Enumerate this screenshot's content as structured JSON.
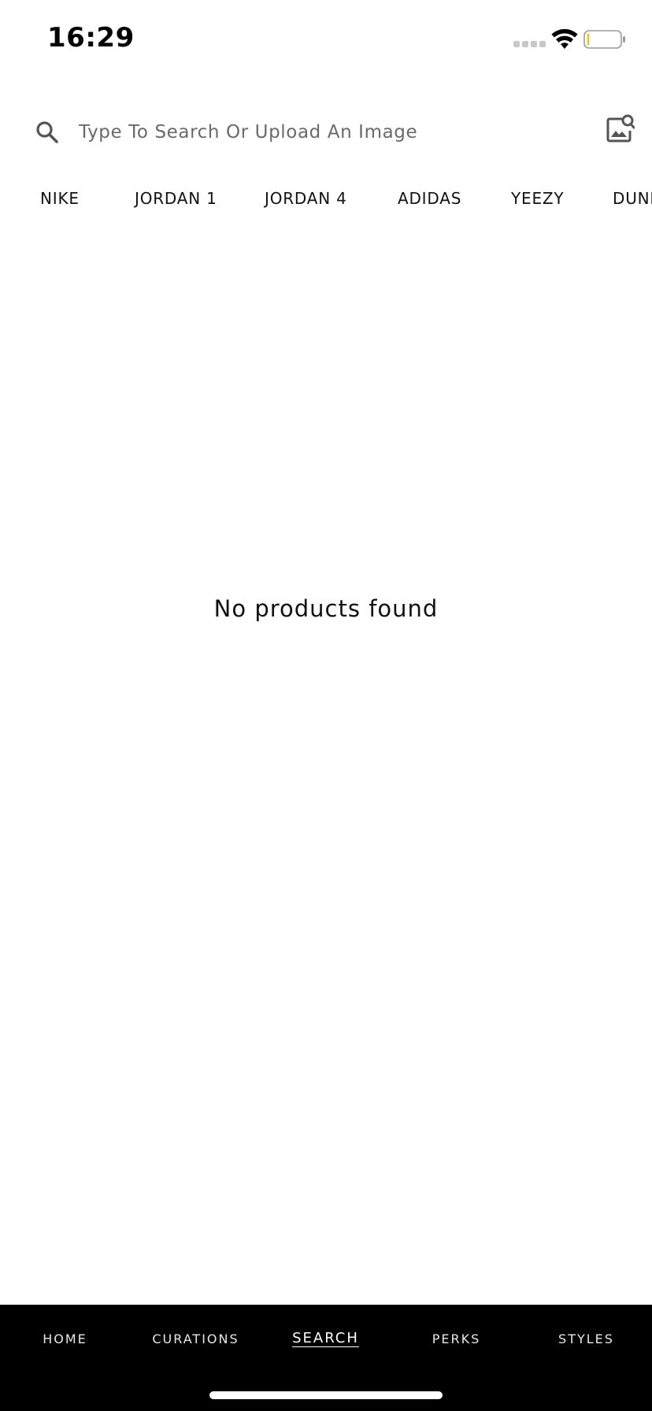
{
  "status_bar": {
    "time": "16:29"
  },
  "search": {
    "placeholder": "Type To Search Or Upload An Image",
    "value": ""
  },
  "brands": [
    "NIKE",
    "JORDAN 1",
    "JORDAN 4",
    "ADIDAS",
    "YEEZY",
    "DUNK"
  ],
  "results": {
    "empty_message": "No products found"
  },
  "bottom_nav": {
    "items": [
      {
        "label": "HOME"
      },
      {
        "label": "CURATIONS"
      },
      {
        "label": "SEARCH"
      },
      {
        "label": "PERKS"
      },
      {
        "label": "STYLES"
      }
    ],
    "active": "SEARCH"
  },
  "colors": {
    "nav_background": "#000000",
    "page_background": "#ffffff",
    "battery_level_indicator": "#e0c84a"
  }
}
